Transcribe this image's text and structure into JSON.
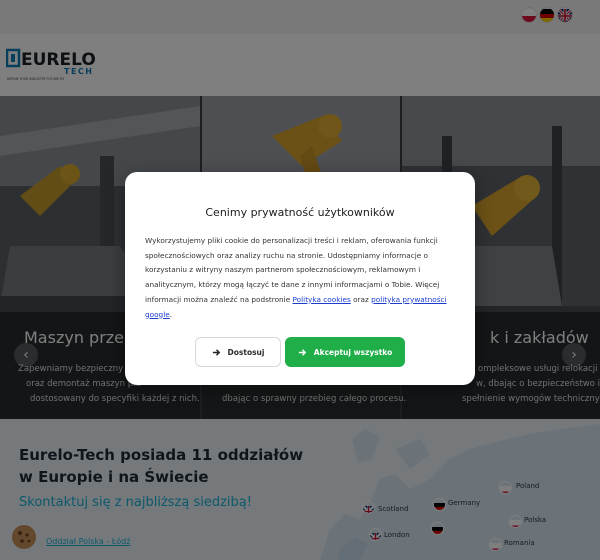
{
  "header": {
    "logo_main": "EURELO",
    "logo_sub": "TECH",
    "logo_tagline": "DEFINE YOUR INDUSTRY FUTURE BY",
    "languages": [
      {
        "name": "polish-flag-icon",
        "colors": [
          "#ffffff",
          "#dc143c"
        ]
      },
      {
        "name": "german-flag-icon",
        "colors": [
          "#000000",
          "#dd0000",
          "#ffce00"
        ]
      },
      {
        "name": "uk-flag-icon",
        "colors": [
          "#012169",
          "#ffffff",
          "#c8102e"
        ]
      }
    ]
  },
  "hero": {
    "panels": [
      {
        "title": "Maszyn przemy",
        "desc": [
          "Zapewniamy bezpieczny i pr",
          "oraz demontaż maszyn prz",
          "dostosowany do specyfiki każdej z nich."
        ]
      },
      {
        "title": "",
        "desc": [
          "",
          "",
          "dbając o sprawny przebieg całego procesu."
        ]
      },
      {
        "title": "k i zakładów",
        "desc": [
          "ompleksowe usługi relokacji",
          "w, dbając o bezpieczeństwo i",
          "spełnienie wymogów technicznych."
        ]
      }
    ],
    "prev_icon": "‹",
    "next_icon": "›"
  },
  "branches": {
    "title": "Eurelo-Tech posiada 11 oddziałów w Europie i na Świecie",
    "subtitle": "Skontaktuj się z najbliższą siedzibą!",
    "link": "Oddział Polska - Łódź",
    "map_labels": [
      "Scotland",
      "Germany",
      "Poland",
      "Polska",
      "London",
      "Romania"
    ]
  },
  "cookie_modal": {
    "title": "Cenimy prywatność użytkowników",
    "body_start": "Wykorzystujemy pliki cookie do personalizacji treści i reklam, oferowania funkcji społecznościowych oraz analizy ruchu na stronie. Udostępniamy informacje o korzystaniu z witryny naszym partnerom społecznościowym, reklamowym i analitycznym, którzy mogą łączyć te dane z innymi informacjami o Tobie. Więcej informacji można znaleźć na podstronie ",
    "link_cookies": "Polityka cookies",
    "body_and": " oraz ",
    "link_privacy": "polityka prywatności google",
    "body_end": ".",
    "btn_customize": "Dostosuj",
    "btn_accept": "Akceptuj wszystko",
    "accent": "#1fae48"
  }
}
